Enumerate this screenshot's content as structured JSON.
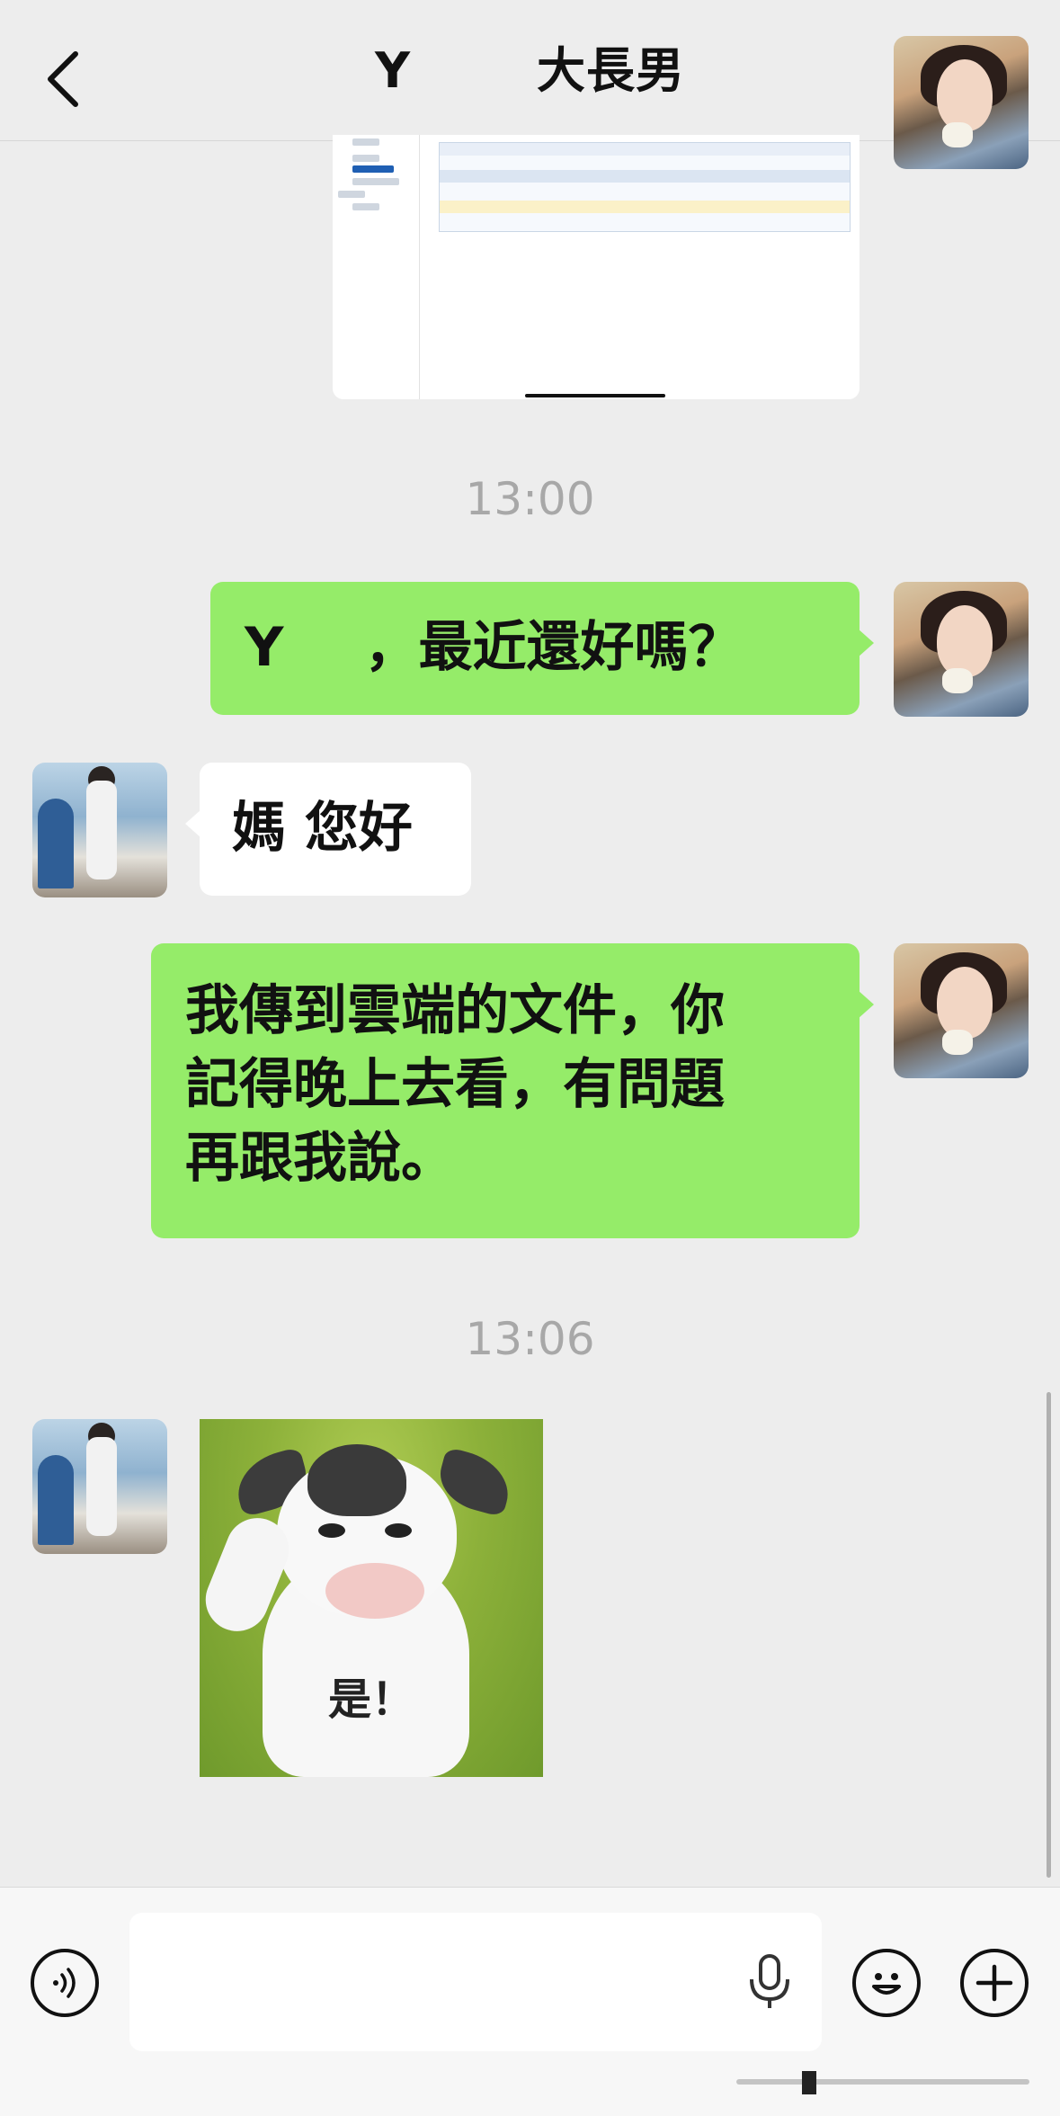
{
  "header": {
    "title": "Y     大長男"
  },
  "messages": [
    {
      "type": "timestamp",
      "text": "13:00"
    },
    {
      "type": "text",
      "direction": "outgoing",
      "text": "Y   ，最近還好嗎？"
    },
    {
      "type": "text",
      "direction": "incoming",
      "text": "媽 您好"
    },
    {
      "type": "text",
      "direction": "outgoing",
      "lines": [
        "我傳到雲端的文件，你",
        "記得晚上去看，有問題",
        "再跟我說。"
      ]
    },
    {
      "type": "timestamp",
      "text": "13:06"
    },
    {
      "type": "sticker",
      "direction": "incoming",
      "caption": "是！"
    }
  ],
  "colors": {
    "background": "#ededed",
    "outgoing_bubble": "#95ec69",
    "incoming_bubble": "#ffffff",
    "timestamp": "#a8a8a8"
  },
  "icons": {
    "back": "chevron-left-icon",
    "more": "more-dots-icon",
    "voice": "voice-wave-icon",
    "mic": "microphone-icon",
    "emoji": "smiley-icon",
    "add": "plus-icon"
  }
}
